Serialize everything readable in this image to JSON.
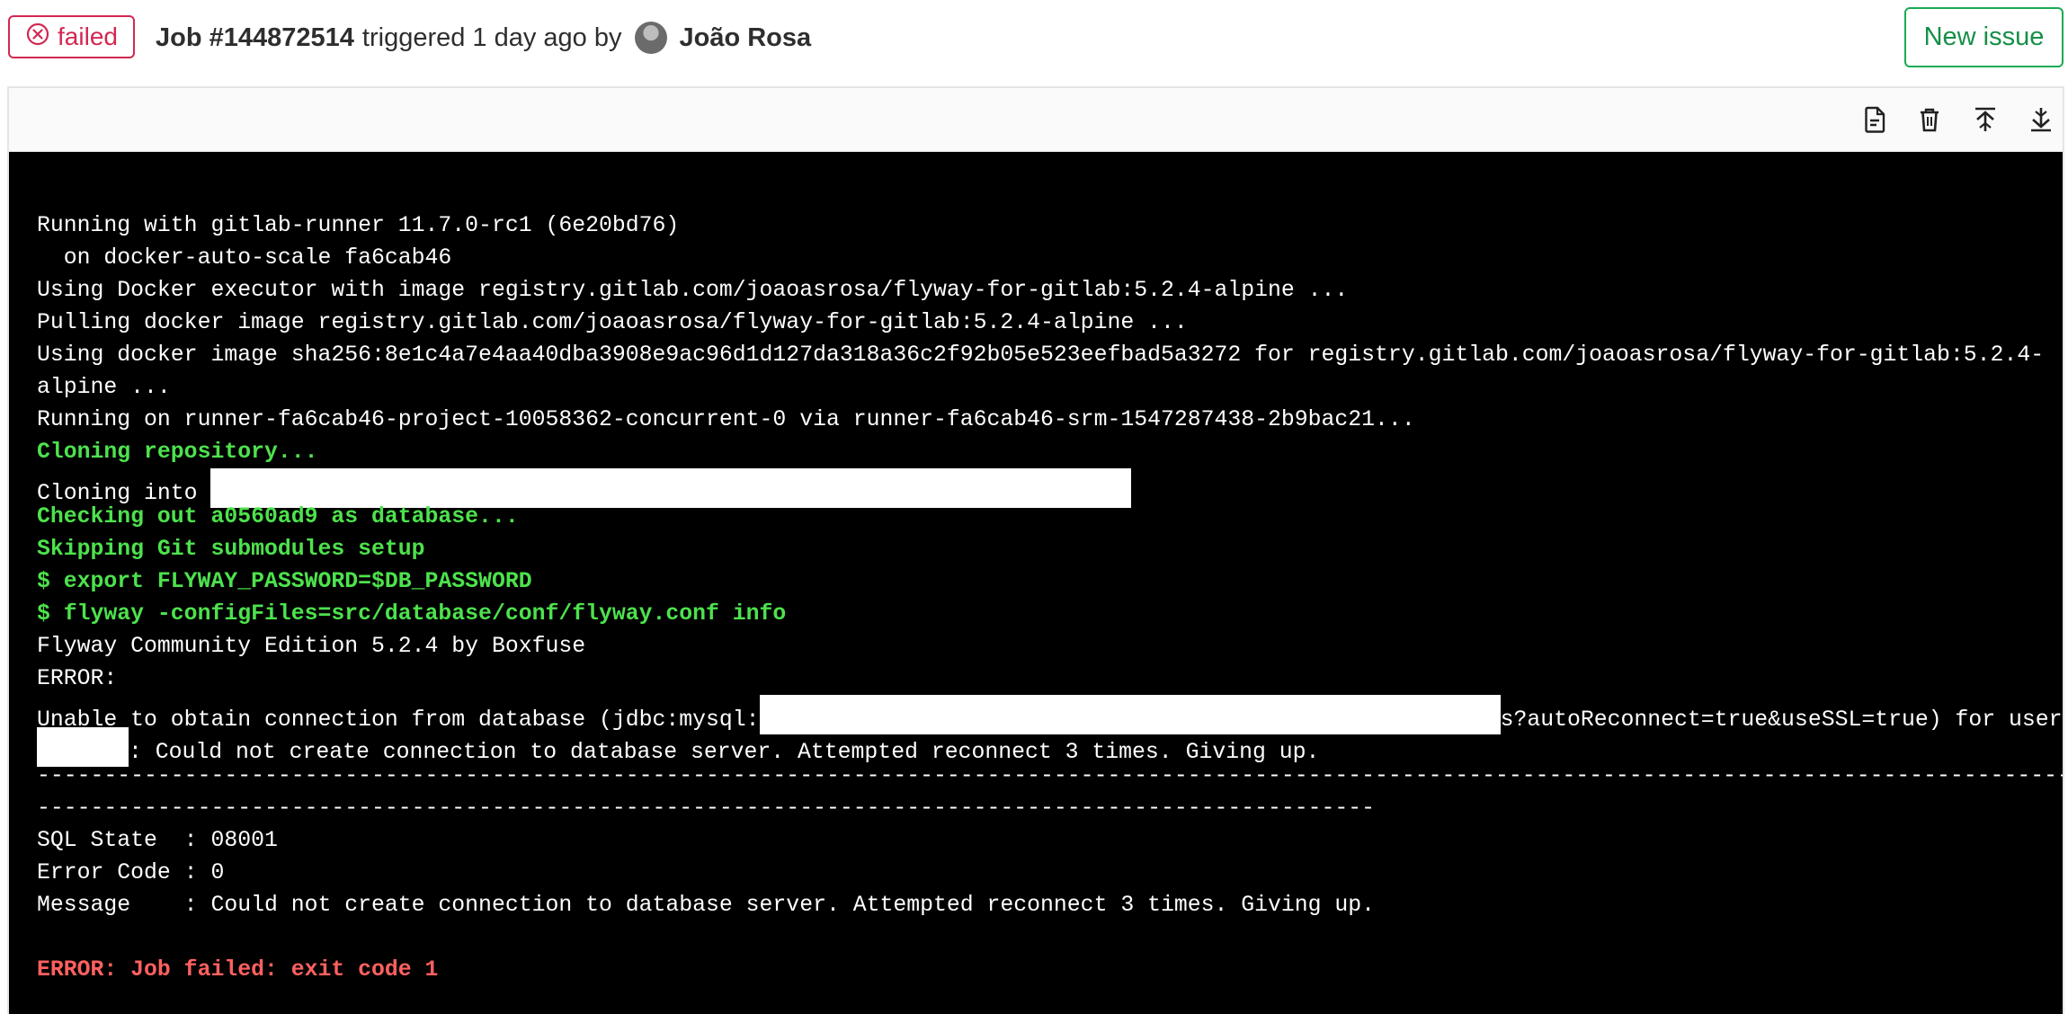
{
  "header": {
    "status": "failed",
    "job_id": "Job #144872514",
    "triggered_text": "triggered 1 day ago by",
    "author": "João Rosa",
    "new_issue_label": "New issue"
  },
  "toolbar": {
    "icons": [
      "raw-log-icon",
      "erase-trash-icon",
      "scroll-top-icon",
      "scroll-bottom-icon"
    ]
  },
  "log": {
    "l1": "Running with gitlab-runner 11.7.0-rc1 (6e20bd76)",
    "l2": "  on docker-auto-scale fa6cab46",
    "l3": "Using Docker executor with image registry.gitlab.com/joaoasrosa/flyway-for-gitlab:5.2.4-alpine ...",
    "l4": "Pulling docker image registry.gitlab.com/joaoasrosa/flyway-for-gitlab:5.2.4-alpine ...",
    "l5": "Using docker image sha256:8e1c4a7e4aa40dba3908e9ac96d1d127da318a36c2f92b05e523eefbad5a3272 for registry.gitlab.com/joaoasrosa/flyway-for-gitlab:5.2.4-",
    "l6": "alpine ...",
    "l7": "Running on runner-fa6cab46-project-10058362-concurrent-0 via runner-fa6cab46-srm-1547287438-2b9bac21...",
    "l8": "Cloning repository...",
    "l9": "Cloning into ",
    "l10": "Checking out a0560ad9 as database...",
    "l11": "Skipping Git submodules setup",
    "l12": "$ export FLYWAY_PASSWORD=$DB_PASSWORD",
    "l13": "$ flyway -configFiles=src/database/conf/flyway.conf info",
    "l14": "Flyway Community Edition 5.2.4 by Boxfuse",
    "l15": "ERROR:",
    "l16a": "Unable to obtain connection from database (jdbc:mysql:",
    "l16b": "s?autoReconnect=true&useSSL=true) for user",
    "l17": ": Could not create connection to database server. Attempted reconnect 3 times. Giving up.",
    "l18": "------------------------------------------------------------------------------------------------------------------------------------------------------------",
    "l19": "----------------------------------------------------------------------------------------------------",
    "l20": "SQL State  : 08001",
    "l21": "Error Code : 0",
    "l22": "Message    : Could not create connection to database server. Attempted reconnect 3 times. Giving up.",
    "l23": "ERROR: Job failed: exit code 1"
  }
}
